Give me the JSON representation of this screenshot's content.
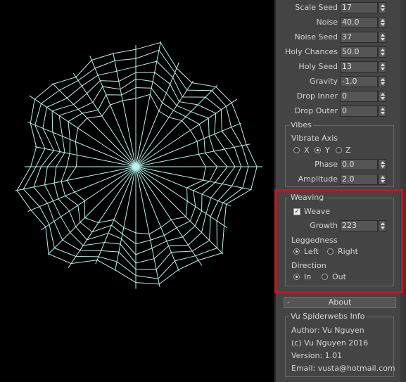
{
  "parameters": [
    {
      "label": "Scale Seed",
      "value": "17"
    },
    {
      "label": "Noise",
      "value": "40.0"
    },
    {
      "label": "Noise Seed",
      "value": "37"
    },
    {
      "label": "Holy Chances",
      "value": "50.0"
    },
    {
      "label": "Holy Seed",
      "value": "13"
    },
    {
      "label": "Gravity",
      "value": "-1.0"
    },
    {
      "label": "Drop Inner",
      "value": "0"
    },
    {
      "label": "Drop Outer",
      "value": "0"
    }
  ],
  "vibes": {
    "title": "Vibes",
    "axis_label": "Vibrate Axis",
    "axes": [
      "X",
      "Y",
      "Z"
    ],
    "selected_axis": "Y",
    "phase_label": "Phase",
    "phase_value": "0.0",
    "amplitude_label": "Amplitude",
    "amplitude_value": "2.0"
  },
  "weaving": {
    "title": "Weaving",
    "weave_label": "Weave",
    "weave_checked": true,
    "growth_label": "Growth",
    "growth_value": "223",
    "leggedness_label": "Leggedness",
    "leggedness_options": [
      "Left",
      "Right"
    ],
    "leggedness_selected": "Left",
    "direction_label": "Direction",
    "direction_options": [
      "In",
      "Out"
    ],
    "direction_selected": "In"
  },
  "about": {
    "rollout_toggle": "-",
    "rollout_title": "About",
    "group_title": "Vu Spiderwebs Info",
    "author": "Author: Vu Nguyen",
    "copyright": "(c) Vu Nguyen 2016",
    "version": "Version: 1.01",
    "email": "Email: vusta@hotmail.com"
  },
  "colors": {
    "web_stroke": "#b9f1ec",
    "highlight": "#d0121b",
    "panel_bg": "#444444",
    "viewport_bg": "#000000"
  }
}
